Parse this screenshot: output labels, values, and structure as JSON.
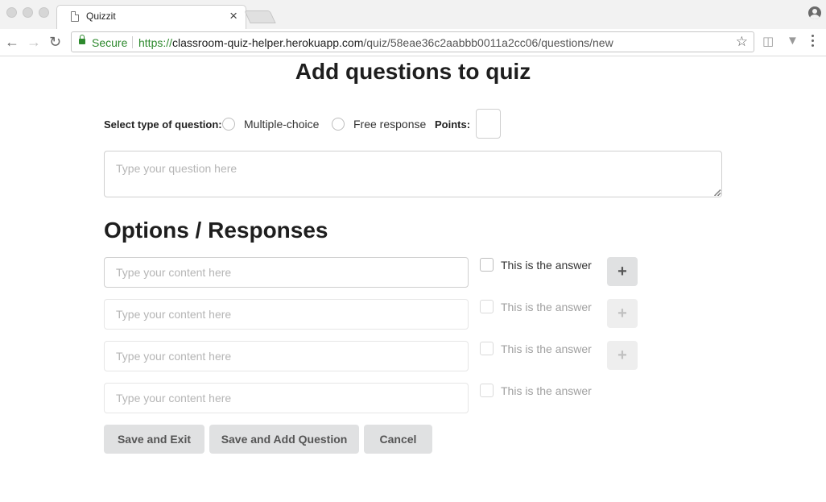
{
  "browser": {
    "tab_title": "Quizzit",
    "tab_close": "×",
    "secure_label": "Secure",
    "url_scheme": "https://",
    "url_host": "classroom-quiz-helper.herokuapp.com",
    "url_path": "/quiz/58eae36c2aabbb0011a2cc06/questions/new"
  },
  "page": {
    "title": "Add questions to quiz"
  },
  "question_type": {
    "label": "Select type of question:",
    "options": [
      "Multiple-choice",
      "Free response"
    ],
    "points_label": "Points:",
    "points_value": ""
  },
  "question": {
    "placeholder": "Type your question here",
    "value": ""
  },
  "options_section": {
    "title": "Options / Responses",
    "items": [
      {
        "placeholder": "Type your content here",
        "value": "",
        "answer_label": "This is the answer",
        "add_label": "+",
        "enabled": true
      },
      {
        "placeholder": "Type your content here",
        "value": "",
        "answer_label": "This is the answer",
        "add_label": "+",
        "enabled": false
      },
      {
        "placeholder": "Type your content here",
        "value": "",
        "answer_label": "This is the answer",
        "add_label": "+",
        "enabled": false
      },
      {
        "placeholder": "Type your content here",
        "value": "",
        "answer_label": "This is the answer",
        "enabled": false
      }
    ]
  },
  "actions": {
    "save_exit": "Save and Exit",
    "save_add": "Save and Add Question",
    "cancel": "Cancel"
  }
}
